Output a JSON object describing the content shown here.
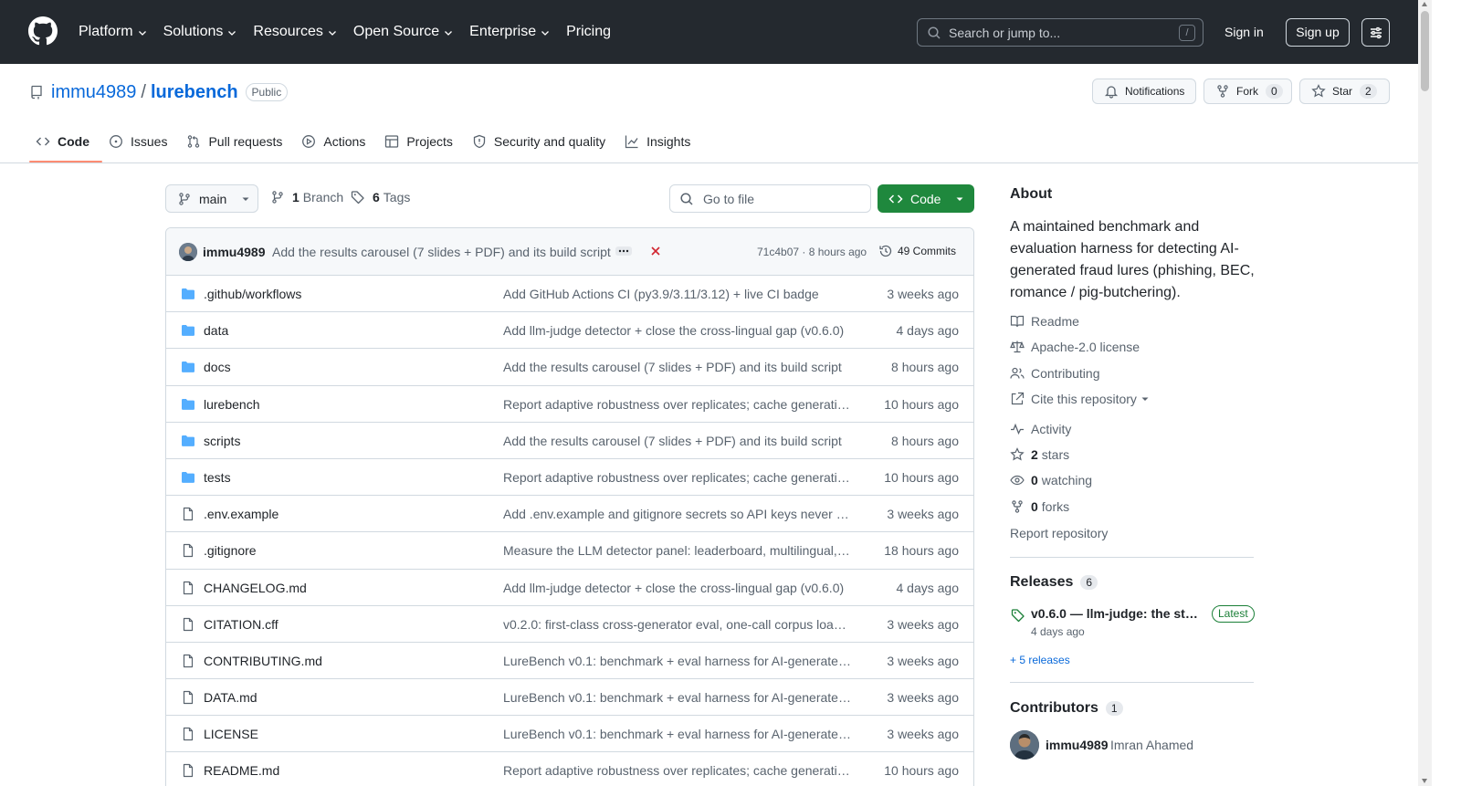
{
  "header": {
    "nav": [
      "Platform",
      "Solutions",
      "Resources",
      "Open Source",
      "Enterprise",
      "Pricing"
    ],
    "search_placeholder": "Search or jump to...",
    "search_shortcut": "/",
    "signin": "Sign in",
    "signup": "Sign up"
  },
  "repo": {
    "owner": "immu4989",
    "separator": "/",
    "name": "lurebench",
    "visibility": "Public",
    "notifications_label": "Notifications",
    "fork_label": "Fork",
    "fork_count": "0",
    "star_label": "Star",
    "star_count": "2"
  },
  "tabs": [
    "Code",
    "Issues",
    "Pull requests",
    "Actions",
    "Projects",
    "Security and quality",
    "Insights"
  ],
  "toolbar": {
    "branch": "main",
    "branch_count": "1",
    "branch_label": "Branch",
    "tag_count": "6",
    "tag_label": "Tags",
    "goto_placeholder": "Go to file",
    "code_button": "Code"
  },
  "commit": {
    "author": "immu4989",
    "message": "Add the results carousel (7 slides + PDF) and its build script",
    "hash_time": "71c4b07 · 8 hours ago",
    "count": "49 Commits"
  },
  "files": [
    {
      "name": ".github/workflows",
      "type": "folder",
      "message": "Add GitHub Actions CI (py3.9/3.11/3.12) + live CI badge",
      "date": "3 weeks ago"
    },
    {
      "name": "data",
      "type": "folder",
      "message": "Add llm-judge detector + close the cross-lingual gap (v0.6.0)",
      "date": "4 days ago"
    },
    {
      "name": "docs",
      "type": "folder",
      "message": "Add the results carousel (7 slides + PDF) and its build script",
      "date": "8 hours ago"
    },
    {
      "name": "lurebench",
      "type": "folder",
      "message": "Report adaptive robustness over replicates; cache generatio…",
      "date": "10 hours ago"
    },
    {
      "name": "scripts",
      "type": "folder",
      "message": "Add the results carousel (7 slides + PDF) and its build script",
      "date": "8 hours ago"
    },
    {
      "name": "tests",
      "type": "folder",
      "message": "Report adaptive robustness over replicates; cache generatio…",
      "date": "10 hours ago"
    },
    {
      "name": ".env.example",
      "type": "file",
      "message": "Add .env.example and gitignore secrets so API keys never g…",
      "date": "3 weeks ago"
    },
    {
      "name": ".gitignore",
      "type": "file",
      "message": "Measure the LLM detector panel: leaderboard, multilingual, …",
      "date": "18 hours ago"
    },
    {
      "name": "CHANGELOG.md",
      "type": "file",
      "message": "Add llm-judge detector + close the cross-lingual gap (v0.6.0)",
      "date": "4 days ago"
    },
    {
      "name": "CITATION.cff",
      "type": "file",
      "message": "v0.2.0: first-class cross-generator eval, one-call corpus load…",
      "date": "3 weeks ago"
    },
    {
      "name": "CONTRIBUTING.md",
      "type": "file",
      "message": "LureBench v0.1: benchmark + eval harness for AI-generated…",
      "date": "3 weeks ago"
    },
    {
      "name": "DATA.md",
      "type": "file",
      "message": "LureBench v0.1: benchmark + eval harness for AI-generated…",
      "date": "3 weeks ago"
    },
    {
      "name": "LICENSE",
      "type": "file",
      "message": "LureBench v0.1: benchmark + eval harness for AI-generated…",
      "date": "3 weeks ago"
    },
    {
      "name": "README.md",
      "type": "file",
      "message": "Report adaptive robustness over replicates; cache generatio…",
      "date": "10 hours ago"
    }
  ],
  "about": {
    "heading": "About",
    "description": "A maintained benchmark and evaluation harness for detecting AI-generated fraud lures (phishing, BEC, romance / pig-butchering).",
    "readme": "Readme",
    "license": "Apache-2.0 license",
    "contributing": "Contributing",
    "cite": "Cite this repository",
    "activity": "Activity",
    "stars_count": "2",
    "stars_label": "stars",
    "watching_count": "0",
    "watching_label": "watching",
    "forks_count": "0",
    "forks_label": "forks",
    "report": "Report repository"
  },
  "releases": {
    "heading": "Releases",
    "count": "6",
    "latest_title": "v0.6.0 — llm-judge: the str…",
    "latest_badge": "Latest",
    "latest_date": "4 days ago",
    "more": "+ 5 releases"
  },
  "contributors": {
    "heading": "Contributors",
    "count": "1",
    "login": "immu4989",
    "name": "Imran Ahamed"
  }
}
